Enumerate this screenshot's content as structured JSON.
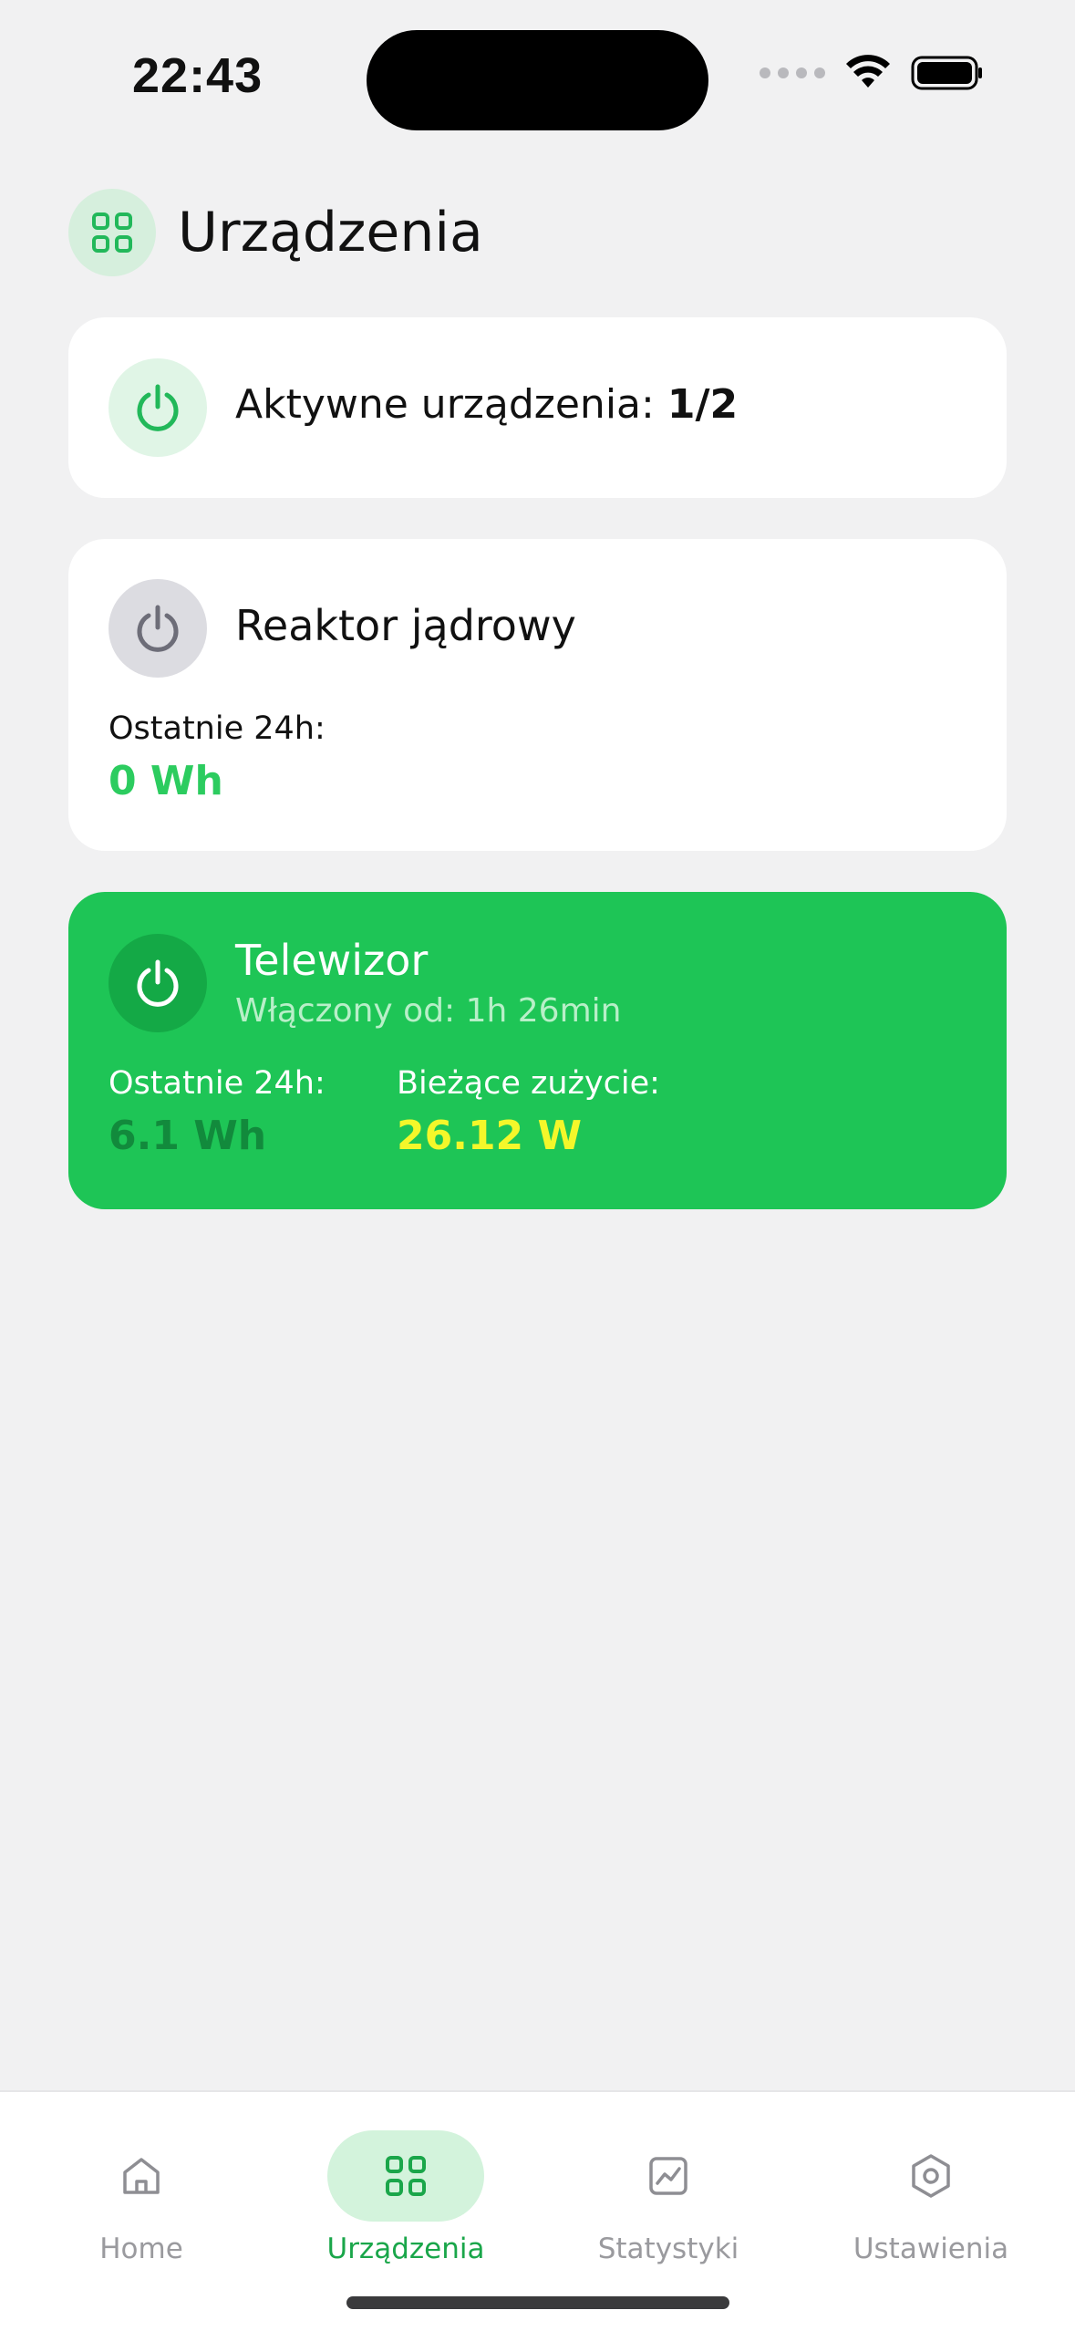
{
  "status_bar": {
    "time": "22:43"
  },
  "header": {
    "title": "Urządzenia",
    "icon": "grid-icon"
  },
  "summary": {
    "label": "Aktywne urządzenia:",
    "value": "1/2"
  },
  "devices": [
    {
      "name": "Reaktor jądrowy",
      "state": "off",
      "last24_label": "Ostatnie 24h:",
      "last24_value": "0 Wh"
    },
    {
      "name": "Telewizor",
      "state": "on",
      "on_since": "Włączony od: 1h 26min",
      "last24_label": "Ostatnie 24h:",
      "last24_value": "6.1 Wh",
      "current_label": "Bieżące zużycie:",
      "current_value": "26.12 W"
    }
  ],
  "nav": [
    {
      "label": "Home",
      "icon": "home-icon",
      "active": false
    },
    {
      "label": "Urządzenia",
      "icon": "grid-icon",
      "active": true
    },
    {
      "label": "Statystyki",
      "icon": "chart-icon",
      "active": false
    },
    {
      "label": "Ustawienia",
      "icon": "settings-icon",
      "active": false
    }
  ],
  "colors": {
    "accent": "#1ec556",
    "accent_dark": "#14a946",
    "highlight_yellow": "#f4f72a",
    "background": "#f1f1f2"
  }
}
